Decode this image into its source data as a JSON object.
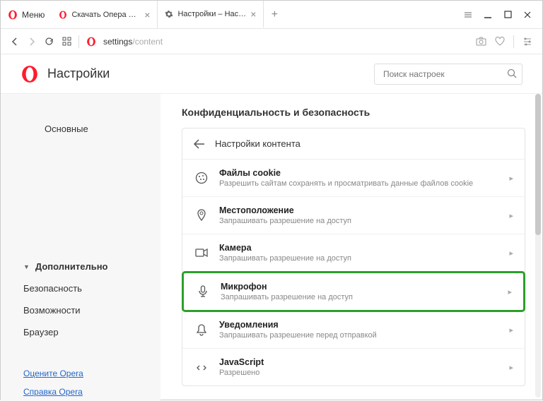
{
  "titlebar": {
    "menu_label": "Меню",
    "tabs": [
      {
        "title": "Скачать Опера для комп",
        "icon": "opera"
      },
      {
        "title": "Настройки – Настройки к",
        "icon": "gear"
      }
    ]
  },
  "addressbar": {
    "url_host": "settings",
    "url_path": "/content"
  },
  "header": {
    "title": "Настройки",
    "search_placeholder": "Поиск настроек"
  },
  "sidebar": {
    "item_main": "Основные",
    "item_advanced": "Дополнительно",
    "subs": [
      "Безопасность",
      "Возможности",
      "Браузер"
    ],
    "links": [
      "Оцените Opera",
      "Справка Opera"
    ]
  },
  "main": {
    "section_title": "Конфиденциальность и безопасность",
    "card_header": "Настройки контента",
    "rows": [
      {
        "icon": "cookie",
        "title": "Файлы cookie",
        "sub": "Разрешить сайтам сохранять и просматривать данные файлов cookie"
      },
      {
        "icon": "location",
        "title": "Местоположение",
        "sub": "Запрашивать разрешение на доступ"
      },
      {
        "icon": "camera",
        "title": "Камера",
        "sub": "Запрашивать разрешение на доступ"
      },
      {
        "icon": "mic",
        "title": "Микрофон",
        "sub": "Запрашивать разрешение на доступ",
        "highlighted": true
      },
      {
        "icon": "bell",
        "title": "Уведомления",
        "sub": "Запрашивать разрешение перед отправкой"
      },
      {
        "icon": "js",
        "title": "JavaScript",
        "sub": "Разрешено"
      }
    ]
  }
}
